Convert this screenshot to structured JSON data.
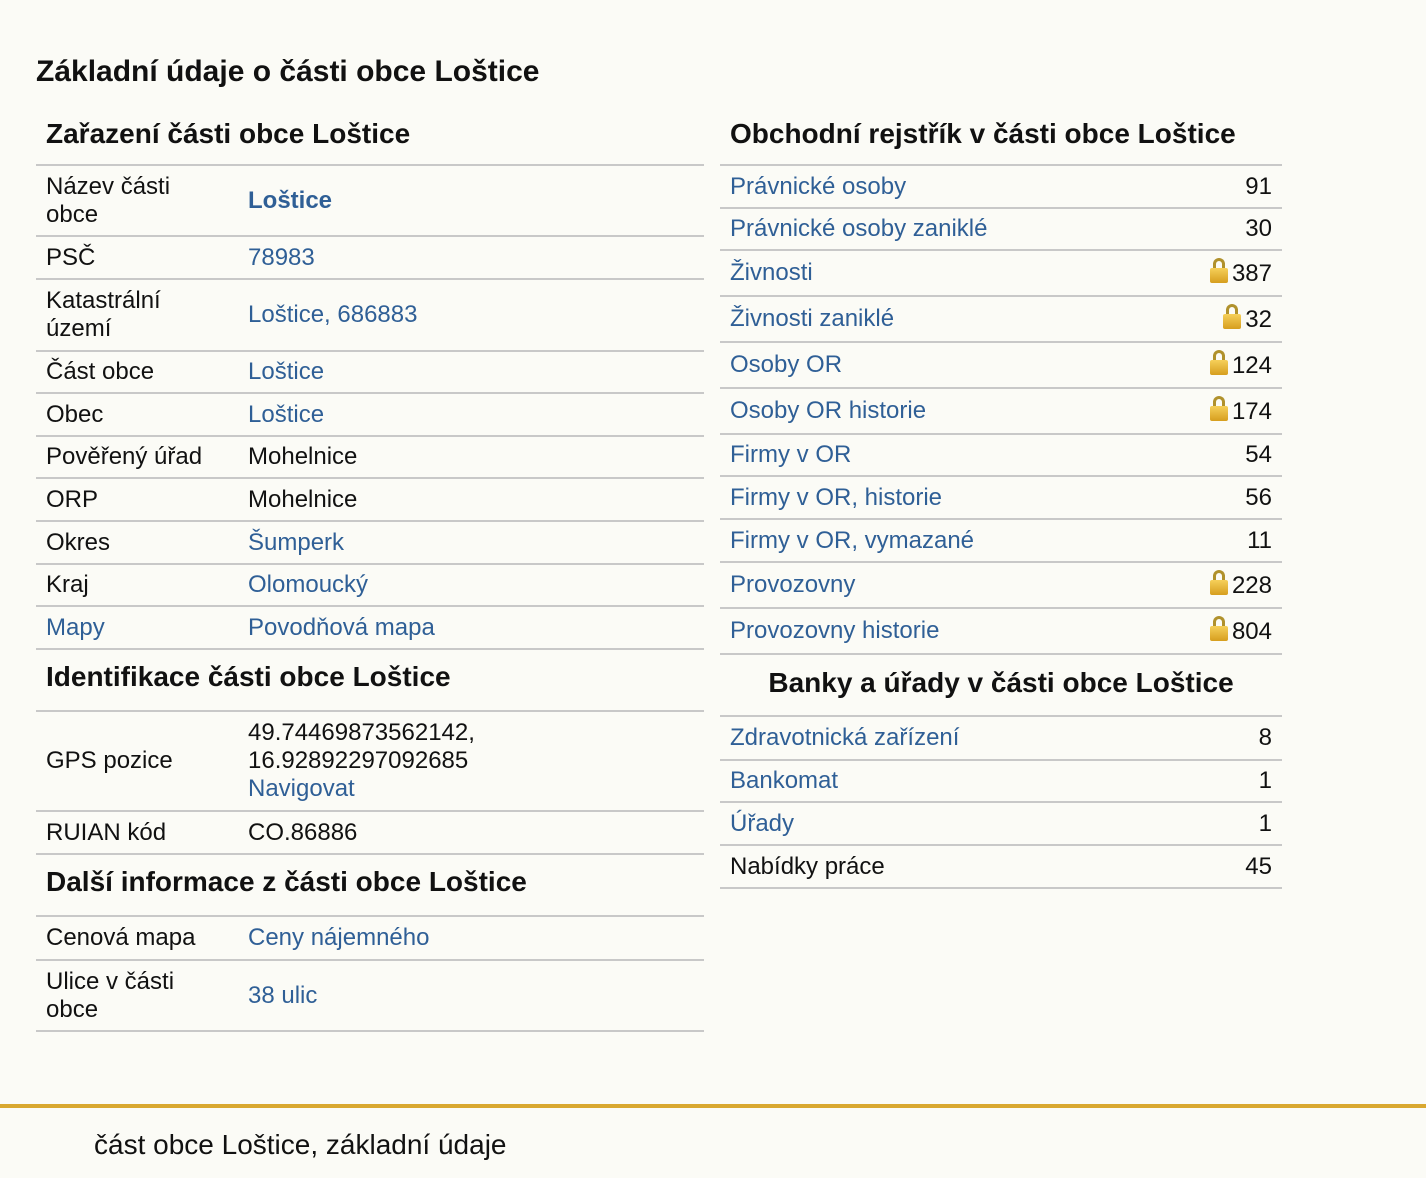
{
  "page_title": "Základní údaje o části obce Loštice",
  "zarazeni": {
    "title": "Zařazení části obce Loštice",
    "rows": [
      {
        "label": "Název části obce",
        "value": "Loštice"
      },
      {
        "label": "PSČ",
        "value": "78983"
      },
      {
        "label": "Katastrální území",
        "value": "Loštice, 686883"
      },
      {
        "label": "Část obce",
        "value": "Loštice"
      },
      {
        "label": "Obec",
        "value": "Loštice"
      },
      {
        "label": "Pověřený úřad",
        "value": "Mohelnice"
      },
      {
        "label": "ORP",
        "value": "Mohelnice"
      },
      {
        "label": "Okres",
        "value": "Šumperk"
      },
      {
        "label": "Kraj",
        "value": "Olomoucký"
      },
      {
        "label": "Mapy",
        "value": "Povodňová mapa"
      }
    ]
  },
  "identifikace": {
    "title": "Identifikace části obce Loštice",
    "gps_label": "GPS pozice",
    "gps_lat": "49.74469873562142,",
    "gps_lon": "16.92892297092685",
    "gps_link": "Navigovat",
    "ruian_label": "RUIAN kód",
    "ruian_value": "CO.86886"
  },
  "dalsi": {
    "title": "Další informace z části obce Loštice",
    "rows": [
      {
        "label": "Cenová mapa",
        "value": "Ceny nájemného"
      },
      {
        "label": "Ulice v části obce",
        "value": "38 ulic"
      }
    ]
  },
  "rejstrik": {
    "title": "Obchodní rejstřík v části obce Loštice",
    "rows": [
      {
        "label": "Právnické osoby",
        "value": "91",
        "locked": false
      },
      {
        "label": "Právnické osoby zaniklé",
        "value": "30",
        "locked": false
      },
      {
        "label": "Živnosti",
        "value": "387",
        "locked": true
      },
      {
        "label": "Živnosti zaniklé",
        "value": "32",
        "locked": true
      },
      {
        "label": "Osoby OR",
        "value": "124",
        "locked": true
      },
      {
        "label": "Osoby OR historie",
        "value": "174",
        "locked": true
      },
      {
        "label": "Firmy v OR",
        "value": "54",
        "locked": false
      },
      {
        "label": "Firmy v OR, historie",
        "value": "56",
        "locked": false
      },
      {
        "label": "Firmy v OR, vymazané",
        "value": "11",
        "locked": false
      },
      {
        "label": "Provozovny",
        "value": "228",
        "locked": true
      },
      {
        "label": "Provozovny historie",
        "value": "804",
        "locked": true
      }
    ]
  },
  "banky": {
    "title": "Banky a úřady v části obce Loštice",
    "rows": [
      {
        "label": "Zdravotnická zařízení",
        "value": "8"
      },
      {
        "label": "Bankomat",
        "value": "1"
      },
      {
        "label": "Úřady",
        "value": "1"
      },
      {
        "label": "Nabídky práce",
        "value": "45"
      }
    ]
  },
  "footer_text": "část obce Loštice, základní údaje",
  "icons": {
    "lock": "lock-icon"
  },
  "colors": {
    "link": "#2f5f96",
    "footer_line": "#d9a830",
    "background": "#fbfbf6"
  }
}
